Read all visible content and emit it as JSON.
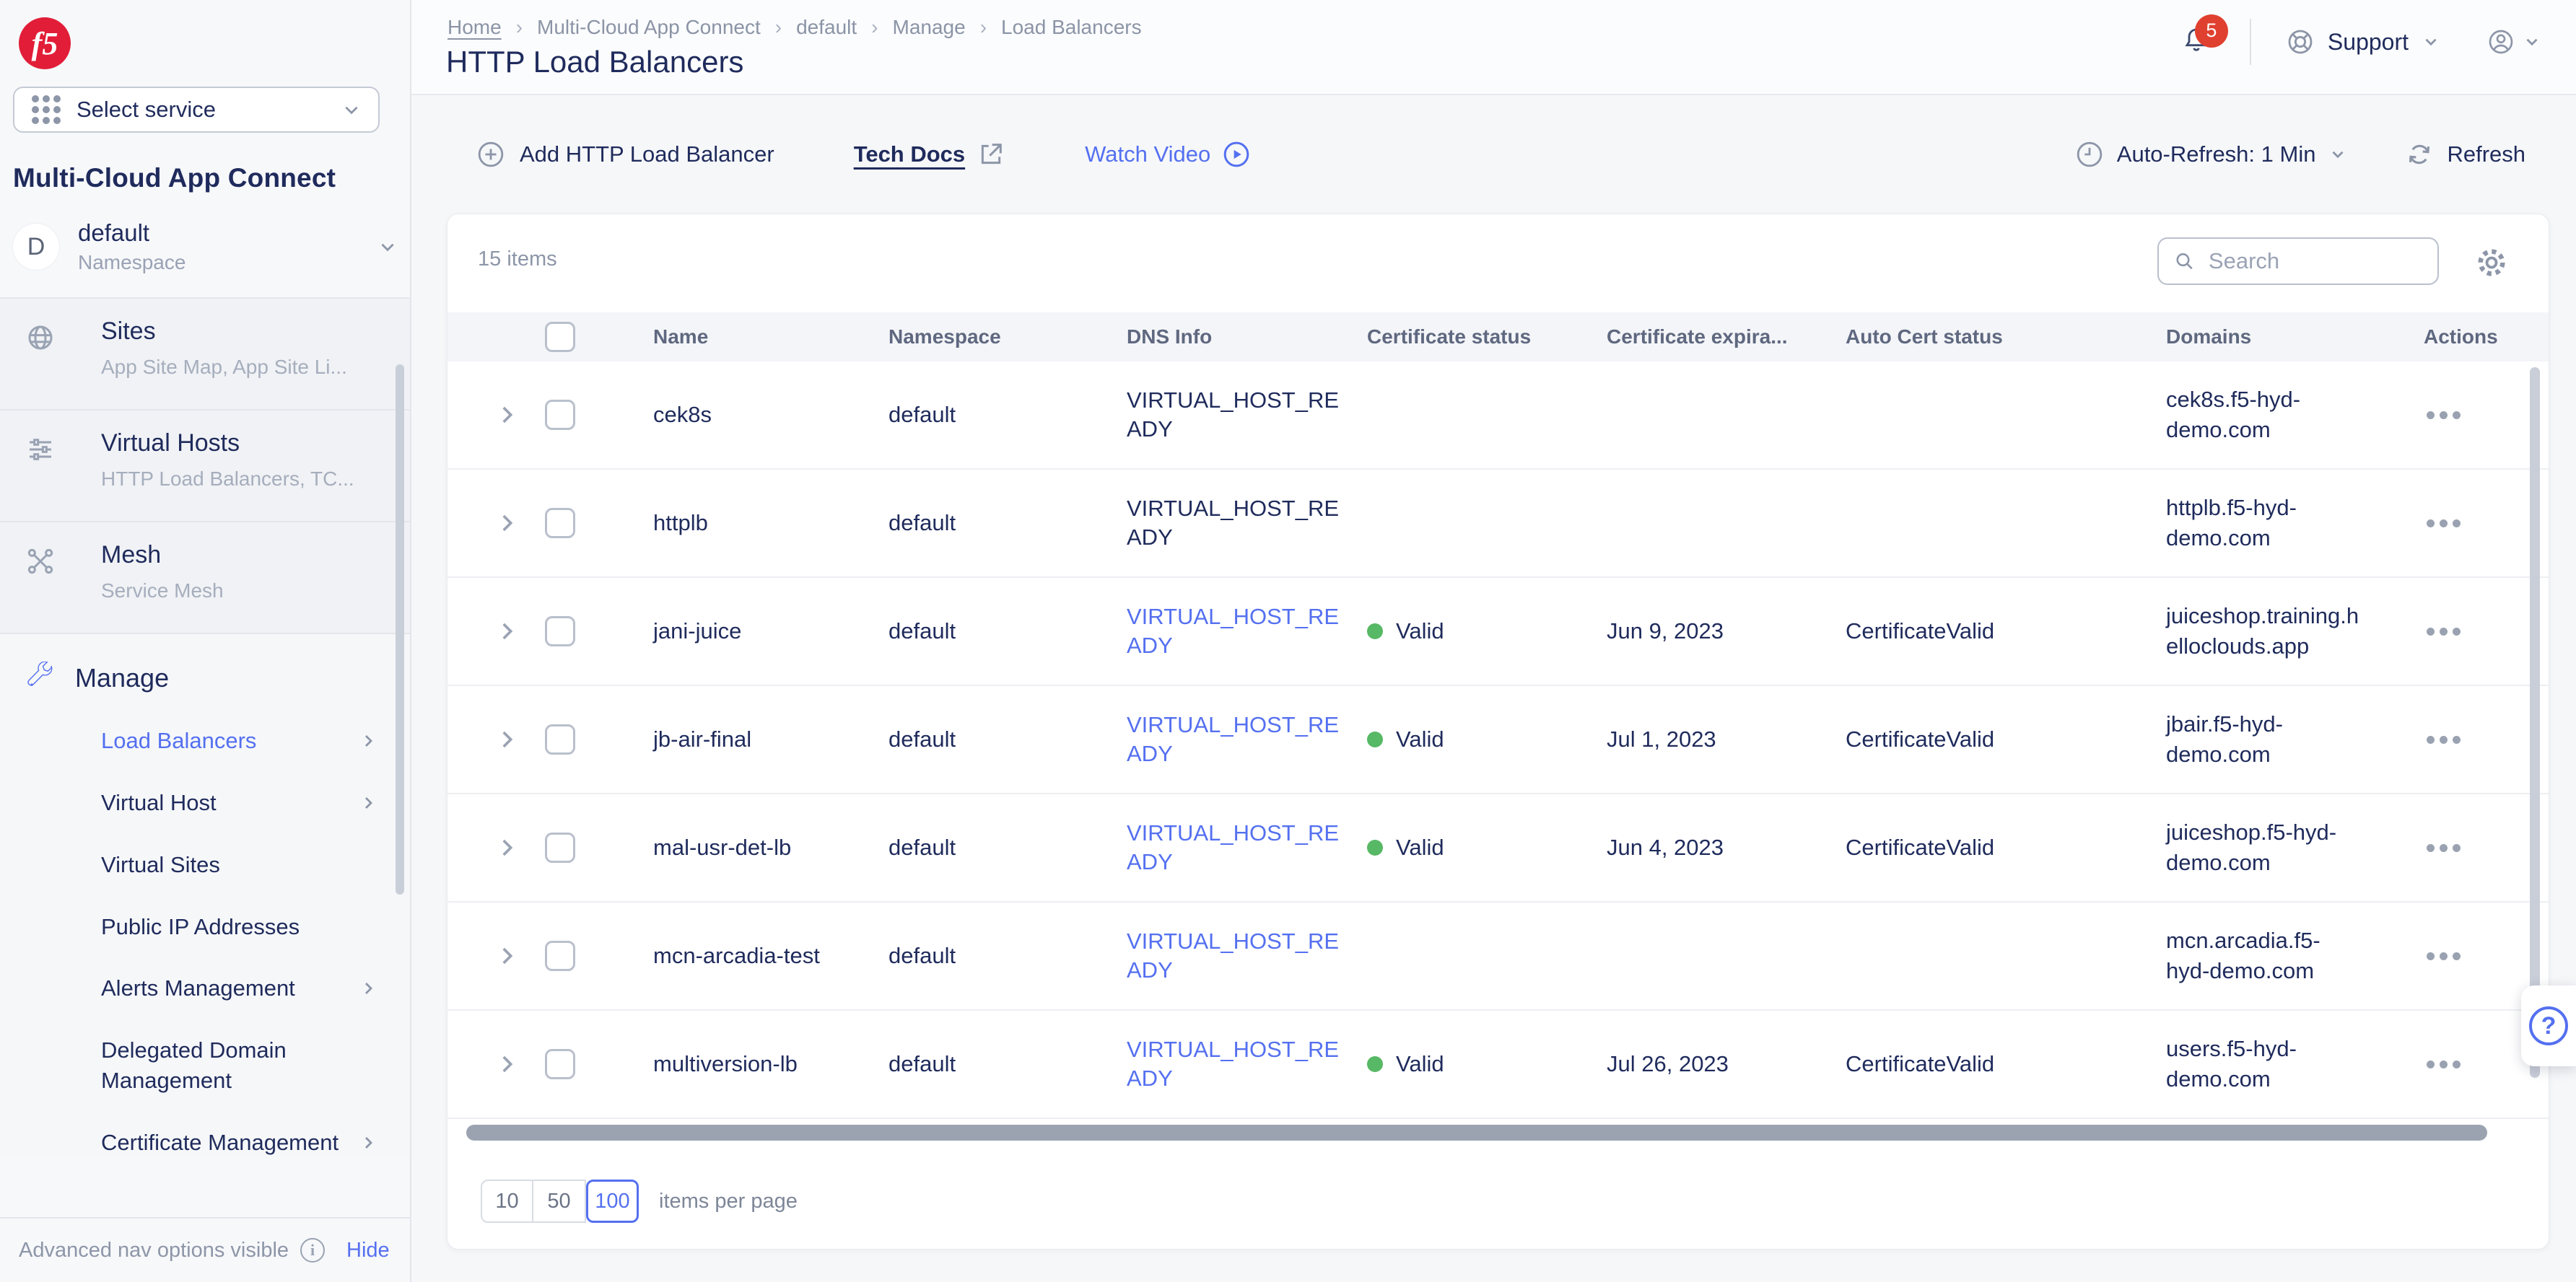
{
  "brand": {
    "logo_text": "f5"
  },
  "sidebar": {
    "select_service": "Select service",
    "product_title": "Multi-Cloud App Connect",
    "namespace": {
      "initial": "D",
      "name": "default",
      "label": "Namespace"
    },
    "sections": [
      {
        "title": "Sites",
        "subtitle": "App Site Map, App Site Li...",
        "icon": "globe-icon"
      },
      {
        "title": "Virtual Hosts",
        "subtitle": "HTTP Load Balancers, TC...",
        "icon": "virtual-hosts-icon"
      },
      {
        "title": "Mesh",
        "subtitle": "Service Mesh",
        "icon": "mesh-icon"
      }
    ],
    "manage": {
      "title": "Manage",
      "items": [
        {
          "label": "Load Balancers",
          "active": true,
          "has_submenu": true
        },
        {
          "label": "Virtual Host",
          "active": false,
          "has_submenu": true
        },
        {
          "label": "Virtual Sites",
          "active": false,
          "has_submenu": false
        },
        {
          "label": "Public IP Addresses",
          "active": false,
          "has_submenu": false
        },
        {
          "label": "Alerts Management",
          "active": false,
          "has_submenu": true
        },
        {
          "label": "Delegated Domain Management",
          "active": false,
          "has_submenu": false
        },
        {
          "label": "Certificate Management",
          "active": false,
          "has_submenu": true
        }
      ]
    },
    "footer": {
      "text": "Advanced nav options visible",
      "action": "Hide"
    }
  },
  "header": {
    "breadcrumb": [
      {
        "label": "Home"
      },
      {
        "label": "Multi-Cloud App Connect"
      },
      {
        "label": "default"
      },
      {
        "label": "Manage"
      },
      {
        "label": "Load Balancers"
      }
    ],
    "title": "HTTP Load Balancers",
    "notification_count": "5",
    "support": "Support"
  },
  "toolbar": {
    "add_button": "Add HTTP Load Balancer",
    "tech_docs": "Tech Docs",
    "watch_video": "Watch Video",
    "auto_refresh": "Auto-Refresh: 1 Min",
    "refresh": "Refresh"
  },
  "table": {
    "items_count": "15 items",
    "search_placeholder": "Search",
    "columns": [
      "Name",
      "Namespace",
      "DNS Info",
      "Certificate status",
      "Certificate expira...",
      "Auto Cert status",
      "Domains",
      "Actions"
    ],
    "rows": [
      {
        "name": "cek8s",
        "namespace": "default",
        "dns_info": "VIRTUAL_HOST_READY",
        "dns_is_link": false,
        "certificate_status": "",
        "certificate_expiration": "",
        "auto_cert_status": "",
        "domain": "cek8s.f5-hyd-demo.com"
      },
      {
        "name": "httplb",
        "namespace": "default",
        "dns_info": "VIRTUAL_HOST_READY",
        "dns_is_link": false,
        "certificate_status": "",
        "certificate_expiration": "",
        "auto_cert_status": "",
        "domain": "httplb.f5-hyd-demo.com"
      },
      {
        "name": "jani-juice",
        "namespace": "default",
        "dns_info": "VIRTUAL_HOST_READY",
        "dns_is_link": true,
        "certificate_status": "Valid",
        "certificate_expiration": "Jun 9, 2023",
        "auto_cert_status": "CertificateValid",
        "domain": "juiceshop.training.helloclouds.app"
      },
      {
        "name": "jb-air-final",
        "namespace": "default",
        "dns_info": "VIRTUAL_HOST_READY",
        "dns_is_link": true,
        "certificate_status": "Valid",
        "certificate_expiration": "Jul 1, 2023",
        "auto_cert_status": "CertificateValid",
        "domain": "jbair.f5-hyd-demo.com"
      },
      {
        "name": "mal-usr-det-lb",
        "namespace": "default",
        "dns_info": "VIRTUAL_HOST_READY",
        "dns_is_link": true,
        "certificate_status": "Valid",
        "certificate_expiration": "Jun 4, 2023",
        "auto_cert_status": "CertificateValid",
        "domain": "juiceshop.f5-hyd-demo.com"
      },
      {
        "name": "mcn-arcadia-test",
        "namespace": "default",
        "dns_info": "VIRTUAL_HOST_READY",
        "dns_is_link": true,
        "certificate_status": "",
        "certificate_expiration": "",
        "auto_cert_status": "",
        "domain": "mcn.arcadia.f5-hyd-demo.com"
      },
      {
        "name": "multiversion-lb",
        "namespace": "default",
        "dns_info": "VIRTUAL_HOST_READY",
        "dns_is_link": true,
        "certificate_status": "Valid",
        "certificate_expiration": "Jul 26, 2023",
        "auto_cert_status": "CertificateValid",
        "domain": "users.f5-hyd-demo.com"
      }
    ]
  },
  "pagination": {
    "options": [
      "10",
      "50",
      "100"
    ],
    "selected": "100",
    "label": "items per page"
  },
  "colors": {
    "accent": "#5470f0",
    "valid_green": "#57b865",
    "badge_red": "#e0402f",
    "logo_red": "#e21d38",
    "navy": "#1f2b5c"
  }
}
